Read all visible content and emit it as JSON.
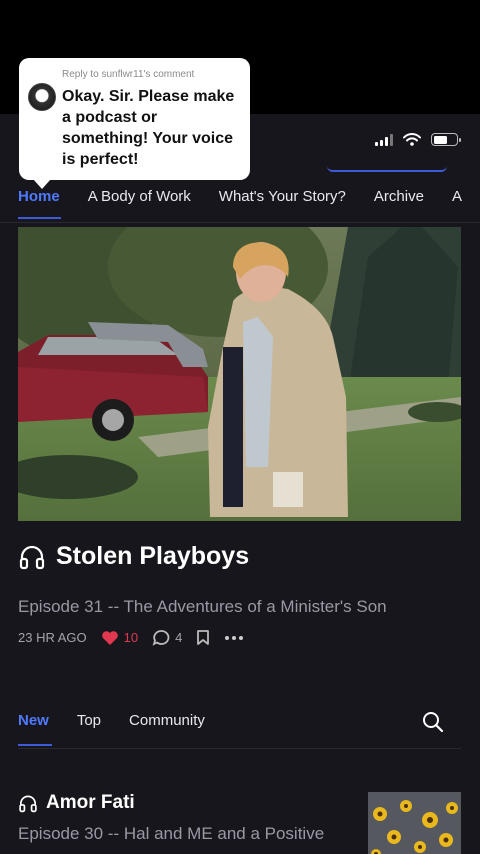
{
  "comment": {
    "reply_to": "Reply to sunflwr11's comment",
    "text": "Okay. Sir. Please make a podcast or something! Your voice is perfect!"
  },
  "nav": {
    "tabs": [
      {
        "label": "Home"
      },
      {
        "label": "A Body of Work"
      },
      {
        "label": "What's Your Story?"
      },
      {
        "label": "Archive"
      },
      {
        "label": "A"
      }
    ]
  },
  "featured": {
    "icon": "headphones-icon",
    "title": "Stolen Playboys",
    "subtitle": "Episode 31 -- The Adventures of a Minister's Son",
    "time": "23 HR AGO",
    "likes": "10",
    "comments": "4"
  },
  "section_tabs": [
    {
      "label": "New"
    },
    {
      "label": "Top"
    },
    {
      "label": "Community"
    }
  ],
  "post": {
    "icon": "headphones-icon",
    "title": "Amor Fati",
    "subtitle": "Episode 30 -- Hal and ME and a Positive"
  },
  "colors": {
    "accent": "#4f79ff",
    "like": "#e0394f",
    "background": "#17161c"
  }
}
